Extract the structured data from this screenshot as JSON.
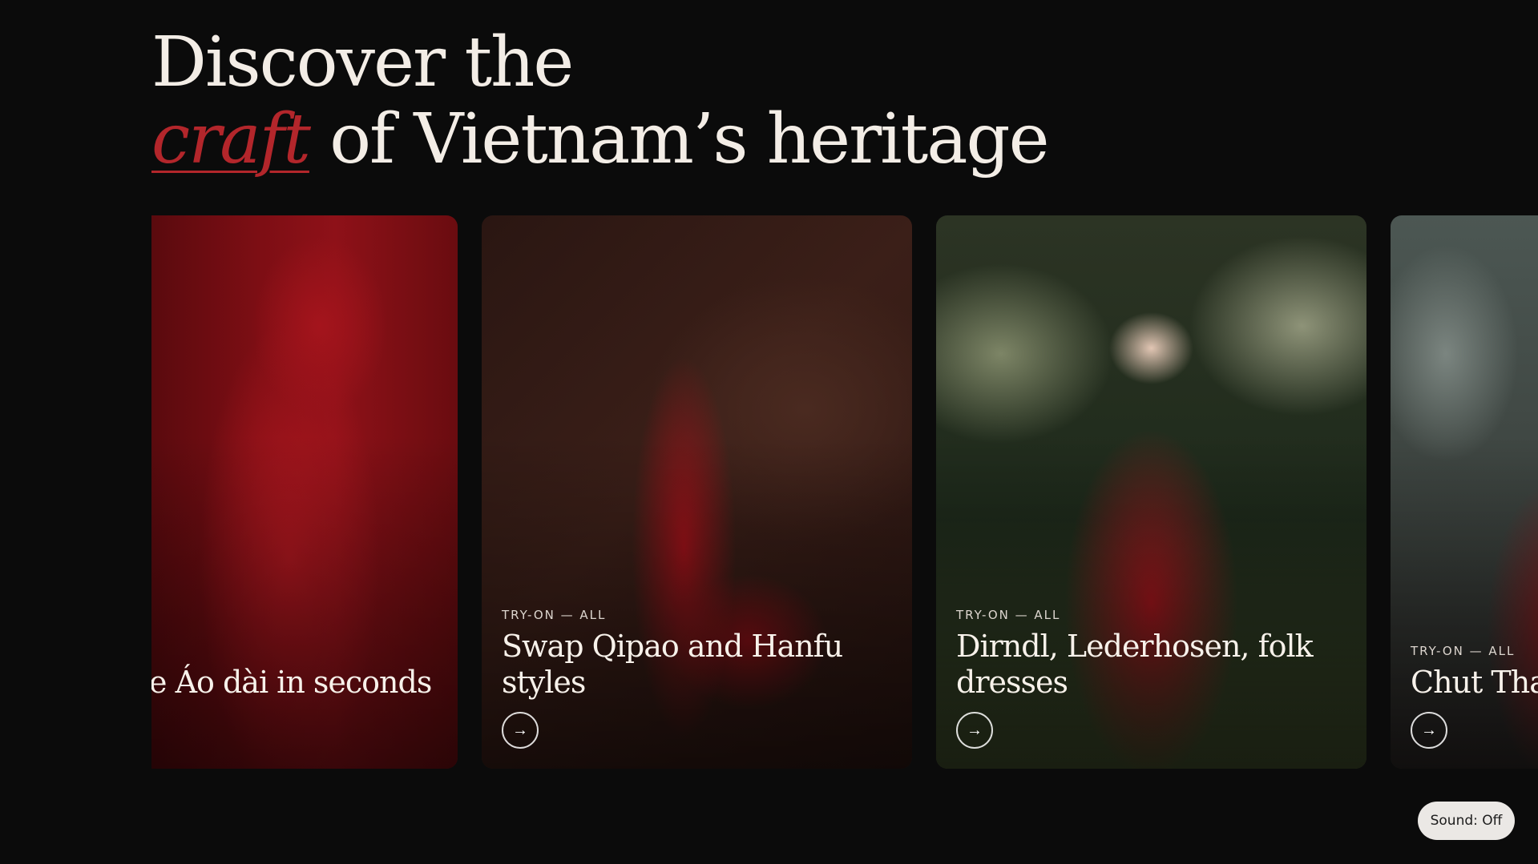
{
  "headline": {
    "line1": "Discover the",
    "accent_word": "craft",
    "line2_rest": " of Vietnam’s heritage"
  },
  "cards": [
    {
      "eyebrow": "",
      "title": "e Áo dài in seconds",
      "cta_icon": "arrow-right-icon"
    },
    {
      "eyebrow": "TRY-ON — ALL",
      "title": "Swap Qipao and Hanfu styles",
      "cta_icon": "arrow-right-icon"
    },
    {
      "eyebrow": "TRY-ON — ALL",
      "title": "Dirndl, Lederhosen, folk dresses",
      "cta_icon": "arrow-right-icon"
    },
    {
      "eyebrow": "TRY-ON — ALL",
      "title": "Chut Tha",
      "cta_icon": "arrow-right-icon"
    }
  ],
  "sound_toggle": {
    "label": "Sound: Off"
  },
  "colors": {
    "background": "#0b0b0b",
    "accent": "#b3262b",
    "text": "#f3ede6"
  }
}
